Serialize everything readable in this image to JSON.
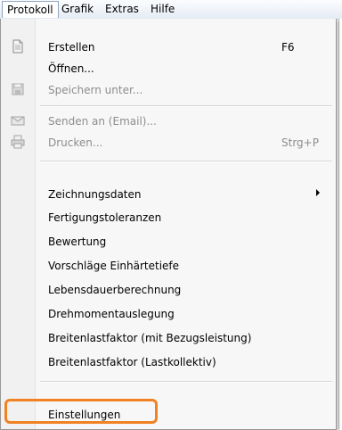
{
  "menubar": {
    "items": [
      "Protokoll",
      "Grafik",
      "Extras",
      "Hilfe"
    ]
  },
  "menu": {
    "items": [
      {
        "label": "Erstellen",
        "shortcut": "F6",
        "icon": "document-icon",
        "enabled": true
      },
      {
        "label": "Öffnen...",
        "enabled": true
      },
      {
        "label": "Speichern unter...",
        "icon": "save-icon",
        "enabled": false
      },
      {
        "label": "Senden an (Email)...",
        "icon": "mail-icon",
        "enabled": false
      },
      {
        "label": "Drucken...",
        "shortcut": "Strg+P",
        "icon": "printer-icon",
        "enabled": false
      },
      {
        "label": "Zeichnungsdaten",
        "submenu": true,
        "enabled": true
      },
      {
        "label": "Fertigungstoleranzen",
        "enabled": true
      },
      {
        "label": "Bewertung",
        "enabled": true
      },
      {
        "label": "Vorschläge Einhärtetiefe",
        "enabled": true
      },
      {
        "label": "Lebensdauerberechnung",
        "enabled": true
      },
      {
        "label": "Drehmomentauslegung",
        "enabled": true
      },
      {
        "label": "Breitenlastfaktor (mit Bezugsleistung)",
        "enabled": true
      },
      {
        "label": "Breitenlastfaktor (Lastkollektiv)",
        "enabled": true
      },
      {
        "label": "Einstellungen",
        "enabled": true,
        "highlighted": true
      }
    ]
  },
  "colors": {
    "highlight_border": "#f08224",
    "menu_background": "#f7f7f7",
    "disabled_text": "#8d8d8d"
  }
}
